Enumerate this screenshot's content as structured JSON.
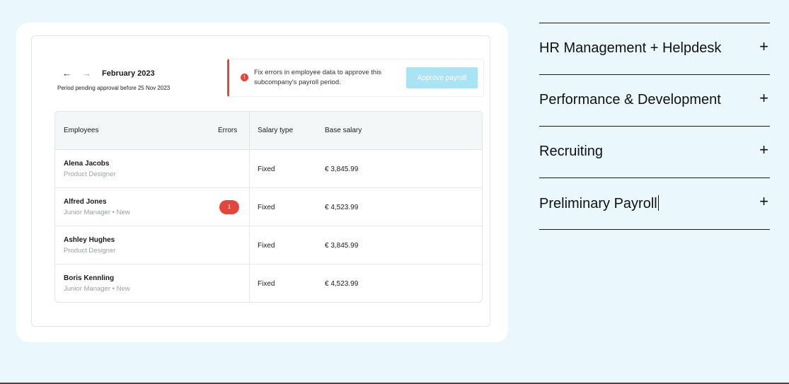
{
  "payroll_card": {
    "period": {
      "prev_icon": "arrow-left-icon",
      "next_icon": "arrow-right-icon",
      "title": "February 2023",
      "subtitle": "Period pending approval before 25 Nov 2023"
    },
    "alert": {
      "icon": "error-icon",
      "icon_glyph": "!",
      "message": "Fix errors in employee data to approve this subcompany's payroll period.",
      "button_label": "Approve payroll"
    },
    "table": {
      "headers": {
        "employees": "Employees",
        "errors": "Errors",
        "salary_type": "Salary type",
        "base_salary": "Base salary"
      },
      "rows": [
        {
          "name": "Alena Jacobs",
          "role": "Product Designer",
          "errors": "",
          "salary_type": "Fixed",
          "base_salary": "€ 3,845.99"
        },
        {
          "name": "Alfred Jones",
          "role": "Junior Manager • New",
          "errors": "1",
          "salary_type": "Fixed",
          "base_salary": "€ 4,523.99"
        },
        {
          "name": "Ashley Hughes",
          "role": "Product Designer",
          "errors": "",
          "salary_type": "Fixed",
          "base_salary": "€ 3,845.99"
        },
        {
          "name": "Boris Kennling",
          "role": "Junior Manager • New",
          "errors": "",
          "salary_type": "Fixed",
          "base_salary": "€ 4,523.99"
        }
      ]
    }
  },
  "accordion": {
    "items": [
      {
        "label": "HR Management + Helpdesk",
        "icon": "plus-icon",
        "glyph": "+"
      },
      {
        "label": "Performance & Development",
        "icon": "plus-icon",
        "glyph": "+"
      },
      {
        "label": "Recruiting",
        "icon": "plus-icon",
        "glyph": "+"
      },
      {
        "label": "Preliminary Payroll",
        "icon": "plus-icon",
        "glyph": "+"
      }
    ]
  },
  "colors": {
    "page_background": "#eaf7fc",
    "error_red": "#e5463b",
    "disabled_button": "#a9e3f4"
  }
}
